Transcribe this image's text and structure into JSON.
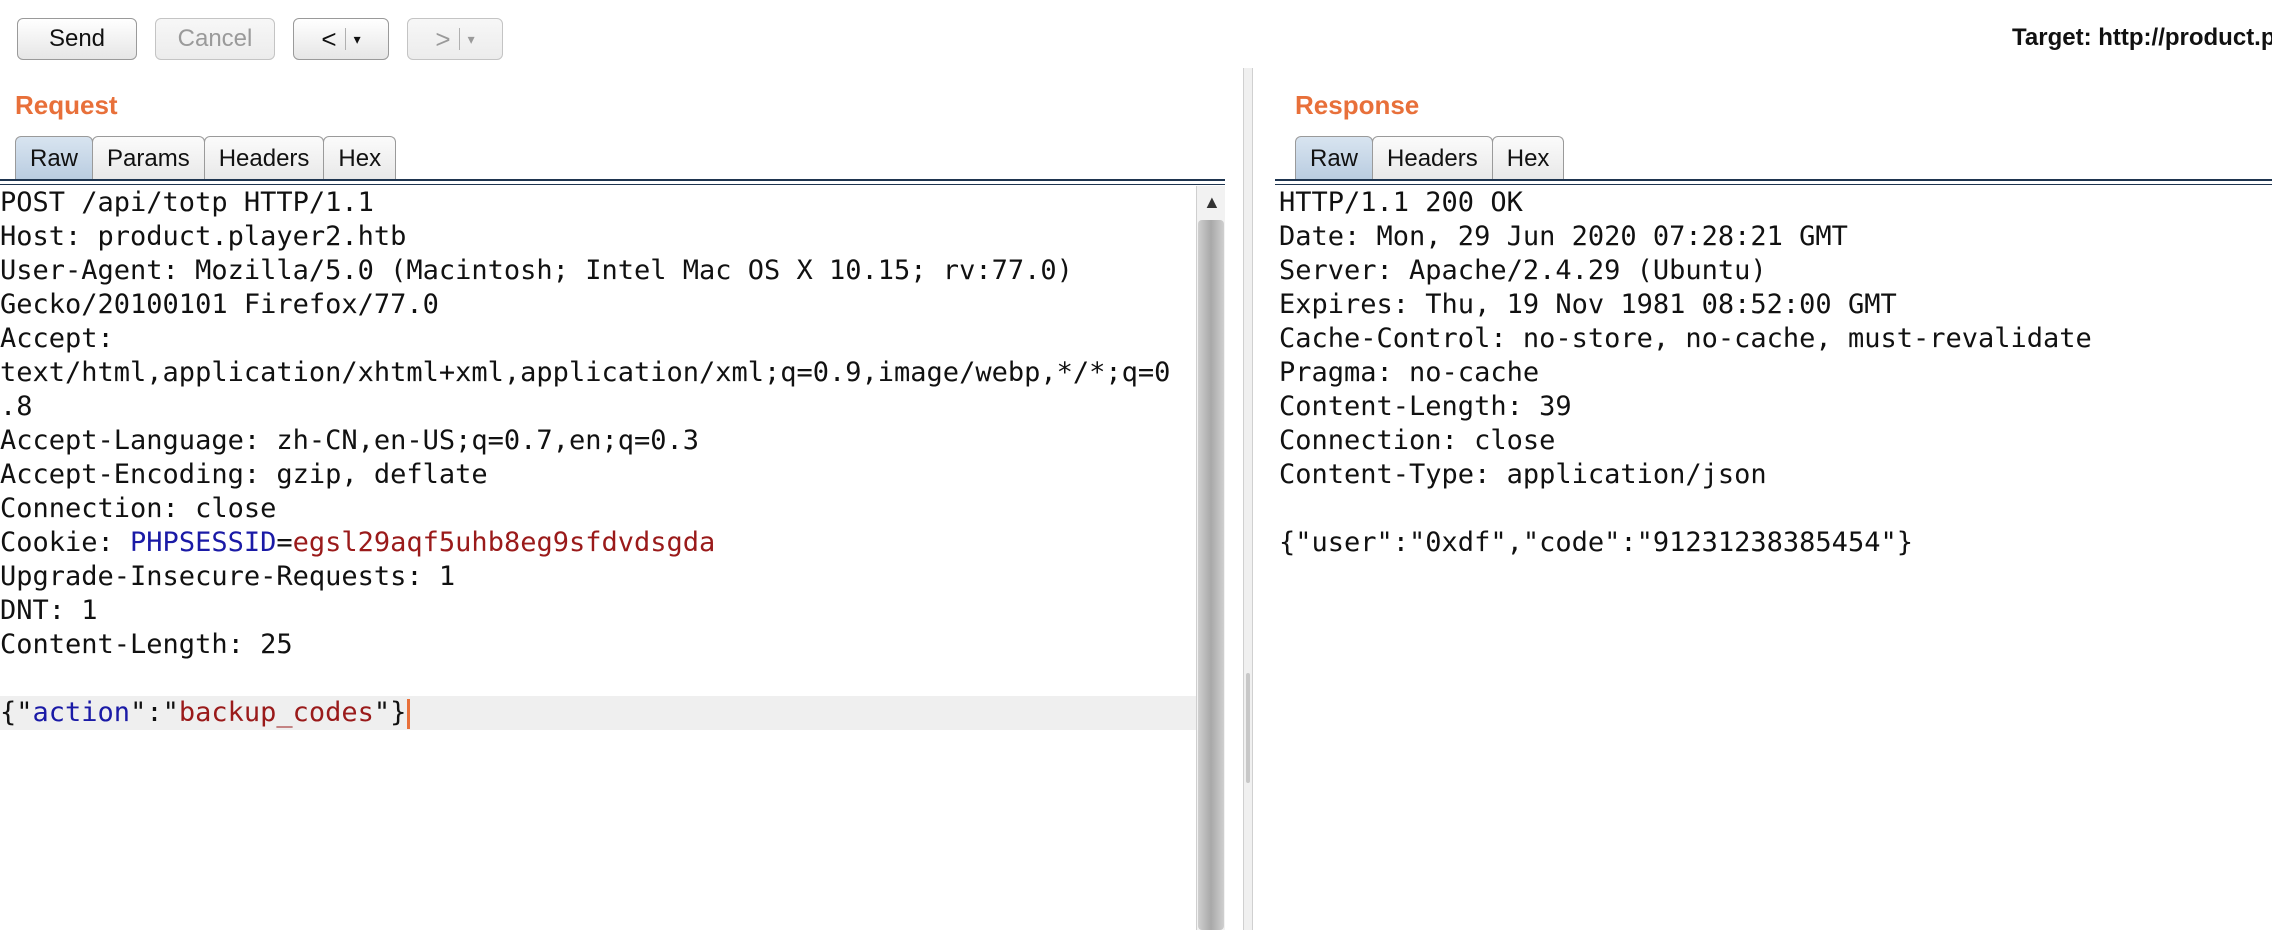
{
  "toolbar": {
    "send_label": "Send",
    "cancel_label": "Cancel",
    "back_label": "<",
    "forward_label": ">",
    "dropdown_glyph": "▾",
    "target_text": "Target: http://product.p"
  },
  "request": {
    "title": "Request",
    "tabs": [
      "Raw",
      "Params",
      "Headers",
      "Hex"
    ],
    "active_tab": "Raw",
    "lines": [
      "POST /api/totp HTTP/1.1",
      "Host: product.player2.htb",
      "User-Agent: Mozilla/5.0 (Macintosh; Intel Mac OS X 10.15; rv:77.0)",
      "Gecko/20100101 Firefox/77.0",
      "Accept:",
      "text/html,application/xhtml+xml,application/xml;q=0.9,image/webp,*/*;q=0",
      ".8",
      "Accept-Language: zh-CN,en-US;q=0.7,en;q=0.3",
      "Accept-Encoding: gzip, deflate",
      "Connection: close"
    ],
    "cookie_prefix": "Cookie: ",
    "cookie_name": "PHPSESSID",
    "cookie_eq": "=",
    "cookie_value": "egsl29aqf5uhb8eg9sfdvdsgda",
    "lines_after_cookie": [
      "Upgrade-Insecure-Requests: 1",
      "DNT: 1",
      "Content-Length: 25",
      ""
    ],
    "body": {
      "open": "{\"",
      "key": "action",
      "mid": "\":\"",
      "value": "backup_codes",
      "close": "\"}"
    }
  },
  "response": {
    "title": "Response",
    "tabs": [
      "Raw",
      "Headers",
      "Hex"
    ],
    "active_tab": "Raw",
    "lines": [
      "HTTP/1.1 200 OK",
      "Date: Mon, 29 Jun 2020 07:28:21 GMT",
      "Server: Apache/2.4.29 (Ubuntu)",
      "Expires: Thu, 19 Nov 1981 08:52:00 GMT",
      "Cache-Control: no-store, no-cache, must-revalidate",
      "Pragma: no-cache",
      "Content-Length: 39",
      "Connection: close",
      "Content-Type: application/json",
      "",
      "{\"user\":\"0xdf\",\"code\":\"91231238385454\"}"
    ]
  },
  "colors": {
    "title_orange": "#e8703a",
    "json_key_blue": "#1a1aa6",
    "json_value_red": "#9a1a1a"
  }
}
